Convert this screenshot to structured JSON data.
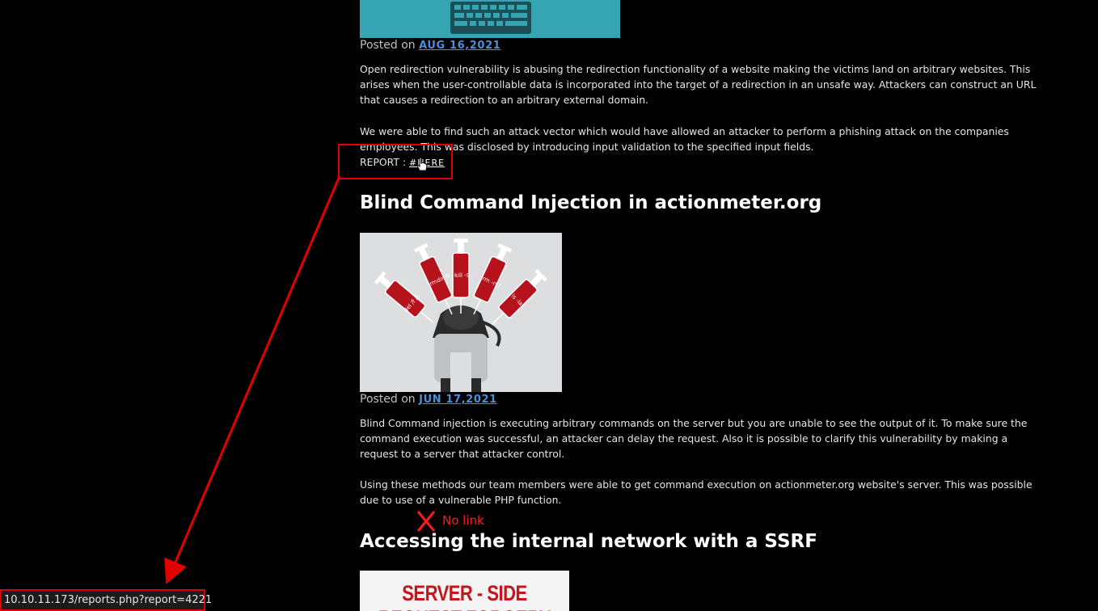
{
  "post1": {
    "posted_prefix": "Posted on",
    "date": "AUG 16,2021",
    "paragraph1": "Open redirection vulnerability is abusing the redirection functionality of a website making the victims land on arbitrary websites. This arises when the user-controllable data is incorporated into the target of a redirection in an unsafe way. Attackers can construct an URL that causes a redirection to an arbitrary external domain.",
    "paragraph2": "We were able to find such an attack vector which would have allowed an attacker to perform a phishing attack on the companies employees. This was disclosed by introducing input validation to the specified input fields.",
    "report_label": "REPORT :",
    "report_link": "#HERE"
  },
  "post2": {
    "title": "Blind Command Injection in actionmeter.org",
    "syringe_labels": [
      "del /f /s",
      "rmdir /s",
      "kill -9",
      "rm -rf /",
      "ls -la"
    ],
    "posted_prefix": "Posted on",
    "date": "JUN 17,2021",
    "paragraph1": "Blind Command injection is executing arbitrary commands on the server but you are unable to see the output of it. To make sure the command execution was successful, an attacker can delay the request. Also it is possible to clarify this vulnerability by making a request to a server that attacker control.",
    "paragraph2": "Using these methods our team members were able to get command execution on actionmeter.org website's server. This was possible due to use of a vulnerable PHP function."
  },
  "post3": {
    "title": "Accessing the internal network with a SSRF",
    "image_text": "SERVER - SIDE REQUEST FORGERY"
  },
  "annotation": {
    "no_link_text": "No link",
    "color": "#e00000"
  },
  "status_bar": {
    "url": "10.10.11.173/reports.php?report=4221"
  }
}
